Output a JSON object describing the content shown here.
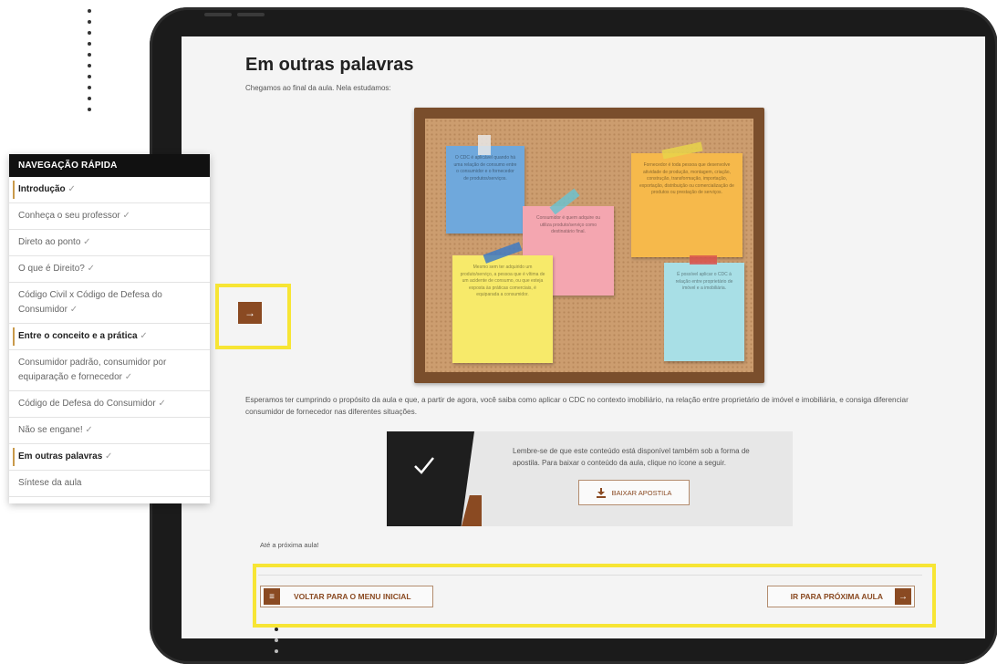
{
  "content": {
    "title": "Em outras palavras",
    "intro": "Chegamos ao final da aula. Nela estudamos:",
    "outro": "Esperamos ter cumprindo o propósito da aula e que, a partir de agora, você saiba como aplicar o CDC no contexto imobiliário, na relação entre proprietário de imóvel e imobiliária, e consiga diferenciar consumidor de fornecedor nas diferentes situações.",
    "download_text": "Lembre-se de que este conteúdo está disponível também sob a forma de apostila. Para baixar o conteúdo da aula, clique no ícone a seguir.",
    "download_button": "BAIXAR APOSTILA",
    "farewell": "Até a próxima aula!"
  },
  "board_notes": [
    {
      "text": "O CDC é aplicável quando há uma relação de consumo entre o consumidor e o fornecedor de produtos/serviços.",
      "color": "#6fa8dc"
    },
    {
      "text": "Consumidor é quem adquire ou utiliza produto/serviço como destinatário final.",
      "color": "#f4a6b0"
    },
    {
      "text": "Fornecedor é toda pessoa que desenvolve atividade de produção, montagem, criação, construção, transformação, importação, exportação, distribuição ou comercialização de produtos ou prestação de serviços.",
      "color": "#f6b94b"
    },
    {
      "text": "Mesmo sem ter adquirido um produto/serviço, a pessoa que é vítima de um acidente de consumo, ou que esteja exposta às práticas comerciais, é equiparada a consumidor.",
      "color": "#f7ea6a"
    },
    {
      "text": "É possível aplicar o CDC à relação entre proprietário de imóvel e a imobiliária.",
      "color": "#a8dfe6"
    }
  ],
  "nav": {
    "back_label": "VOLTAR PARA O MENU INICIAL",
    "next_label": "IR PARA PRÓXIMA AULA",
    "menu_icon": "≡",
    "arrow_icon": "→"
  },
  "quicknav": {
    "title": "NAVEGAÇÃO RÁPIDA",
    "check": "✓",
    "items": [
      {
        "label": "Introdução",
        "active": true,
        "checked": true
      },
      {
        "label": "Conheça o seu professor",
        "active": false,
        "checked": true
      },
      {
        "label": "Direto ao ponto",
        "active": false,
        "checked": true
      },
      {
        "label": "O que é Direito?",
        "active": false,
        "checked": true
      },
      {
        "label": "Código Civil x Código de Defesa do Consumidor",
        "active": false,
        "checked": true
      },
      {
        "label": "Entre o conceito e a prática",
        "active": true,
        "checked": true
      },
      {
        "label": "Consumidor padrão, consumidor por equiparação e fornecedor",
        "active": false,
        "checked": true
      },
      {
        "label": "Código de Defesa do Consumidor",
        "active": false,
        "checked": true
      },
      {
        "label": "Não se engane!",
        "active": false,
        "checked": true
      },
      {
        "label": "Em outras palavras",
        "active": true,
        "checked": true
      },
      {
        "label": "Síntese da aula",
        "active": false,
        "checked": false
      }
    ]
  },
  "colors": {
    "brand_brown": "#8a4a22",
    "highlight_yellow": "#f7e534",
    "active_bar": "#c99a4b"
  }
}
